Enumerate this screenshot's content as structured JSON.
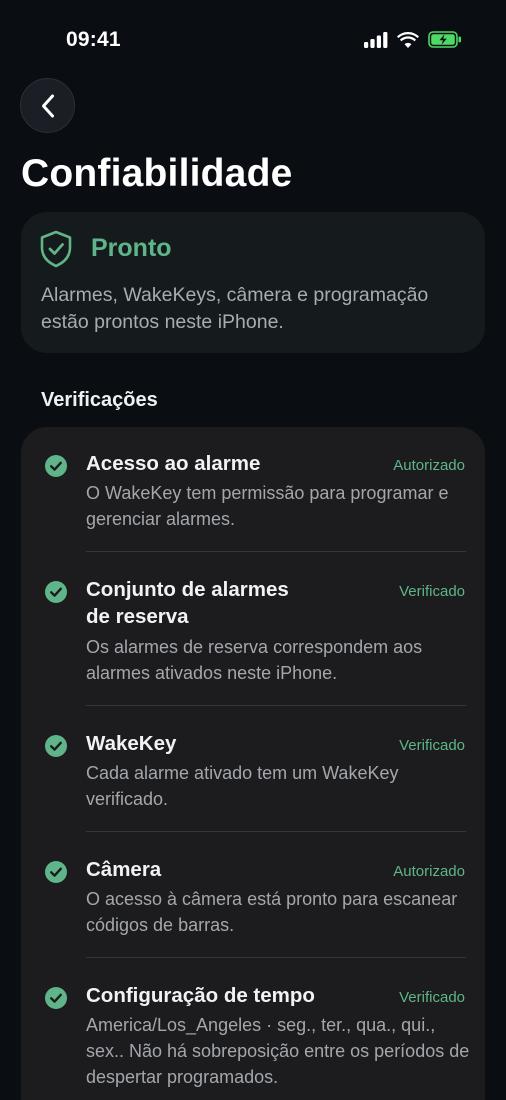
{
  "status_bar": {
    "time": "09:41",
    "icons": [
      "cellular-signal-icon",
      "wifi-icon",
      "battery-charging-icon"
    ]
  },
  "nav": {
    "back_icon": "chevron-left-icon"
  },
  "page": {
    "title": "Confiabilidade"
  },
  "status_card": {
    "icon": "shield-check-icon",
    "title": "Pronto",
    "description": "Alarmes, WakeKeys, câmera e programação estão prontos neste iPhone."
  },
  "checks": {
    "section_title": "Verificações",
    "items": [
      {
        "icon": "checkmark-circle-icon",
        "title": "Acesso ao alarme",
        "status": "Autorizado",
        "description": "O WakeKey tem permissão para programar e gerenciar alarmes."
      },
      {
        "icon": "checkmark-circle-icon",
        "title": "Conjunto de alarmes de reserva",
        "status": "Verificado",
        "description": "Os alarmes de reserva correspondem aos alarmes ativados neste iPhone."
      },
      {
        "icon": "checkmark-circle-icon",
        "title": "WakeKey",
        "status": "Verificado",
        "description": "Cada alarme ativado tem um WakeKey verificado."
      },
      {
        "icon": "checkmark-circle-icon",
        "title": "Câmera",
        "status": "Autorizado",
        "description": "O acesso à câmera está pronto para escanear códigos de barras."
      },
      {
        "icon": "checkmark-circle-icon",
        "title": "Configuração de tempo",
        "status": "Verificado",
        "description": "America/Los_Angeles · seg., ter., qua., qui., sex.. Não há sobreposição entre os períodos de despertar programados."
      }
    ]
  },
  "colors": {
    "background": "#0a0d12",
    "accent_green": "#5fb589",
    "card": "#1c1c1e",
    "status_card": "#151b1d"
  }
}
